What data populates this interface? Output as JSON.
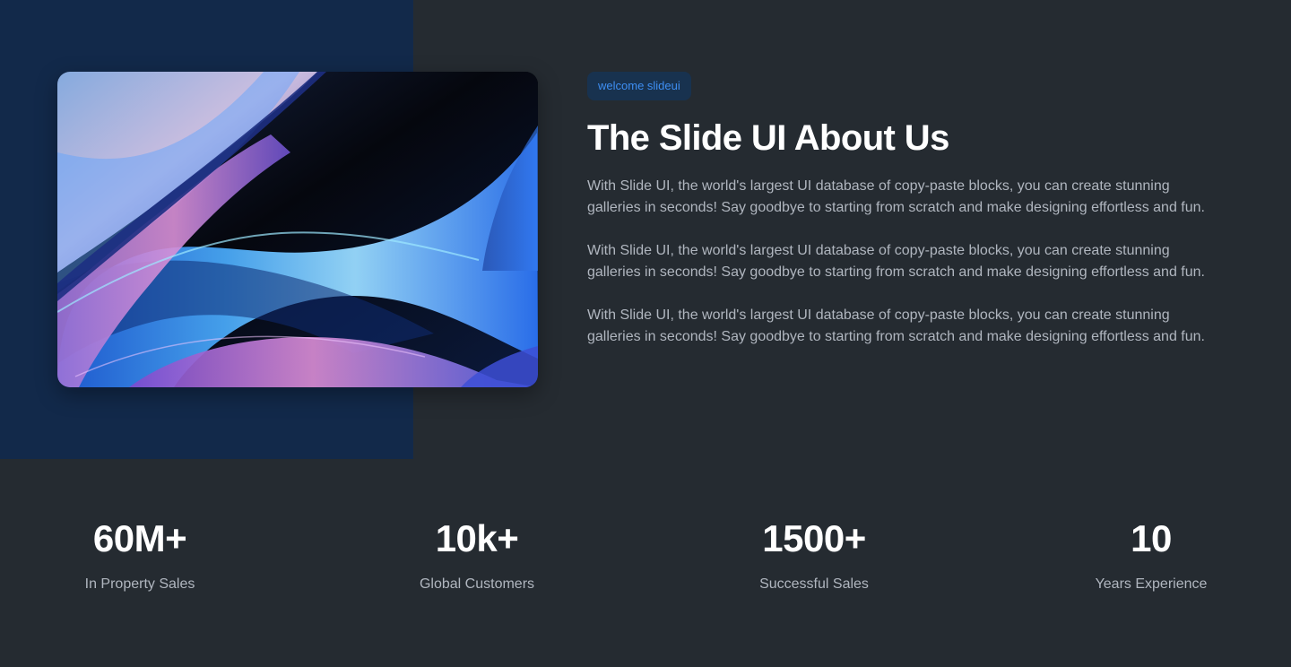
{
  "badge": "welcome slideui",
  "title": "The Slide UI About Us",
  "paragraphs": [
    "With Slide UI, the world's largest UI database of copy-paste blocks, you can create stunning galleries in seconds! Say goodbye to starting from scratch and make designing effortless and fun.",
    "With Slide UI, the world's largest UI database of copy-paste blocks, you can create stunning galleries in seconds! Say goodbye to starting from scratch and make designing effortless and fun.",
    "With Slide UI, the world's largest UI database of copy-paste blocks, you can create stunning galleries in seconds! Say goodbye to starting from scratch and make designing effortless and fun."
  ],
  "stats": [
    {
      "value": "60M+",
      "label": "In Property Sales"
    },
    {
      "value": "10k+",
      "label": "Global Customers"
    },
    {
      "value": "1500+",
      "label": "Successful Sales"
    },
    {
      "value": "10",
      "label": "Years Experience"
    }
  ],
  "colors": {
    "page_background": "#252b31",
    "left_panel": "#12294a",
    "accent": "#3e8ef2",
    "badge_background": "#18324f",
    "heading": "#ffffff",
    "body_text": "#b0b6bf"
  },
  "image": {
    "name": "abstract-wave-artwork"
  }
}
